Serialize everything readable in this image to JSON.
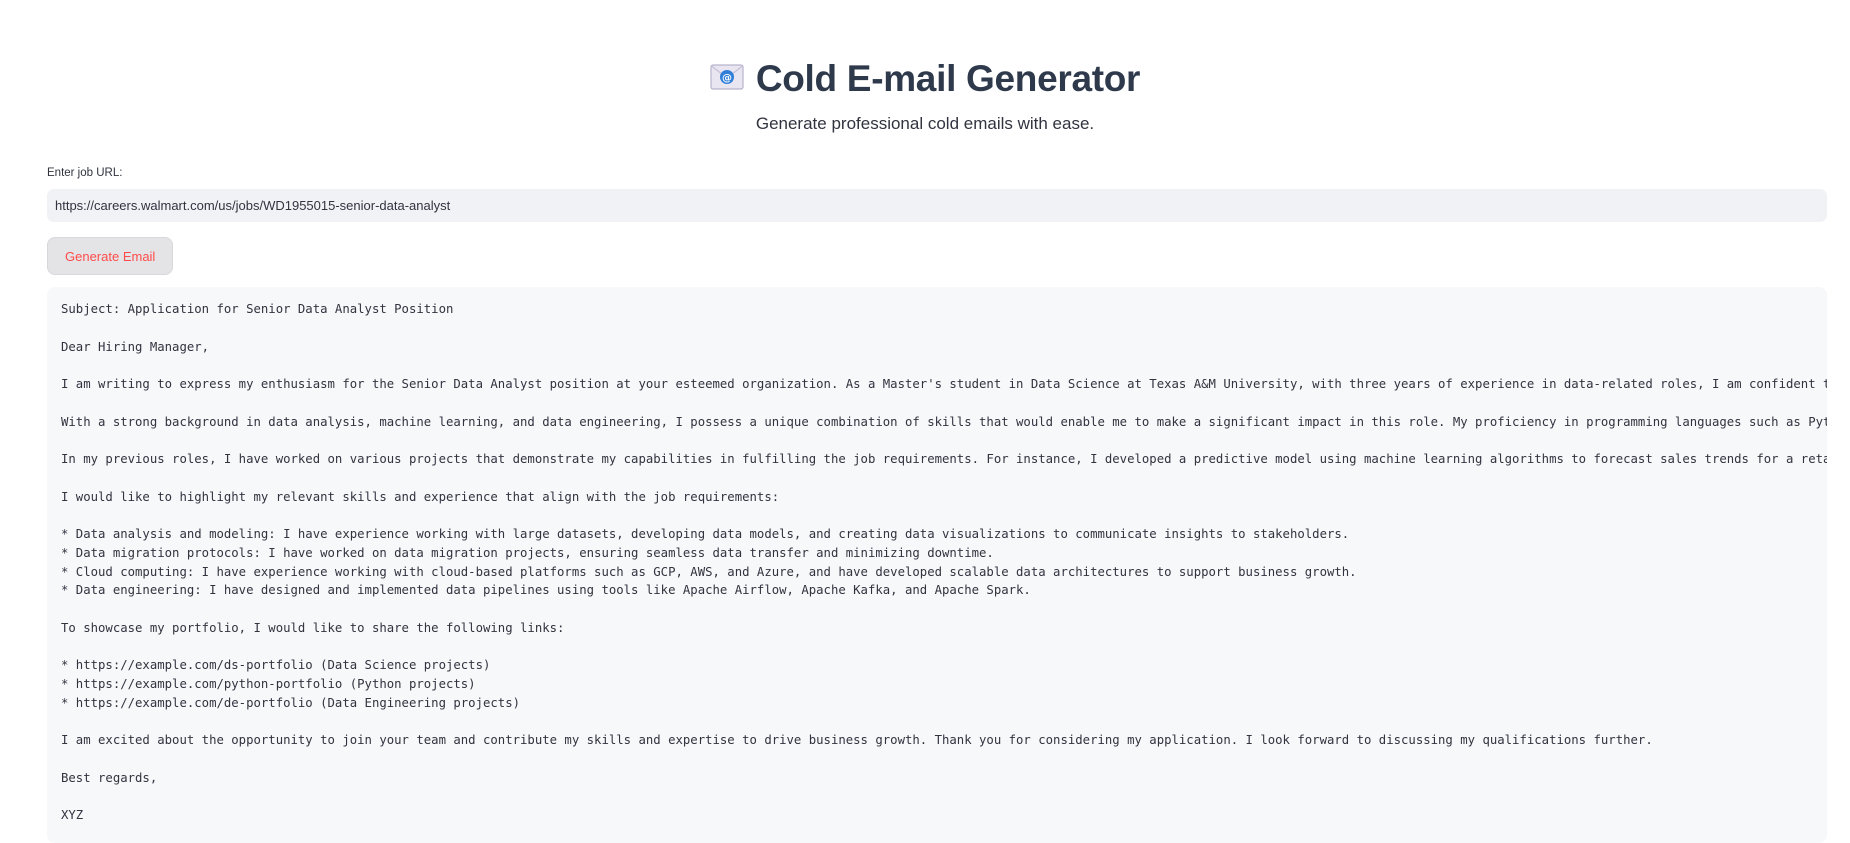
{
  "header": {
    "icon": "envelope-icon",
    "title": "Cold E-mail Generator",
    "subtitle": "Generate professional cold emails with ease."
  },
  "url_input": {
    "label": "Enter job URL:",
    "value": "https://careers.walmart.com/us/jobs/WD1955015-senior-data-analyst"
  },
  "generate_button": {
    "label": "Generate Email"
  },
  "email": {
    "lines": [
      "Subject: Application for Senior Data Analyst Position",
      "",
      "Dear Hiring Manager,",
      "",
      "I am writing to express my enthusiasm for the Senior Data Analyst position at your esteemed organization. As a Master's student in Data Science at Texas A&M University, with three years of experience in data-related roles, I am confident that my skills",
      "",
      "With a strong background in data analysis, machine learning, and data engineering, I possess a unique combination of skills that would enable me to make a significant impact in this role. My proficiency in programming languages such as Python, Java, an",
      "",
      "In my previous roles, I have worked on various projects that demonstrate my capabilities in fulfilling the job requirements. For instance, I developed a predictive model using machine learning algorithms to forecast sales trends for a retail company, r",
      "",
      "I would like to highlight my relevant skills and experience that align with the job requirements:",
      "",
      "* Data analysis and modeling: I have experience working with large datasets, developing data models, and creating data visualizations to communicate insights to stakeholders.",
      "* Data migration protocols: I have worked on data migration projects, ensuring seamless data transfer and minimizing downtime.",
      "* Cloud computing: I have experience working with cloud-based platforms such as GCP, AWS, and Azure, and have developed scalable data architectures to support business growth.",
      "* Data engineering: I have designed and implemented data pipelines using tools like Apache Airflow, Apache Kafka, and Apache Spark.",
      "",
      "To showcase my portfolio, I would like to share the following links:",
      "",
      "* https://example.com/ds-portfolio (Data Science projects)",
      "* https://example.com/python-portfolio (Python projects)",
      "* https://example.com/de-portfolio (Data Engineering projects)",
      "",
      "I am excited about the opportunity to join your team and contribute my skills and expertise to drive business growth. Thank you for considering my application. I look forward to discussing my qualifications further.",
      "",
      "Best regards,",
      "",
      "XYZ"
    ]
  }
}
